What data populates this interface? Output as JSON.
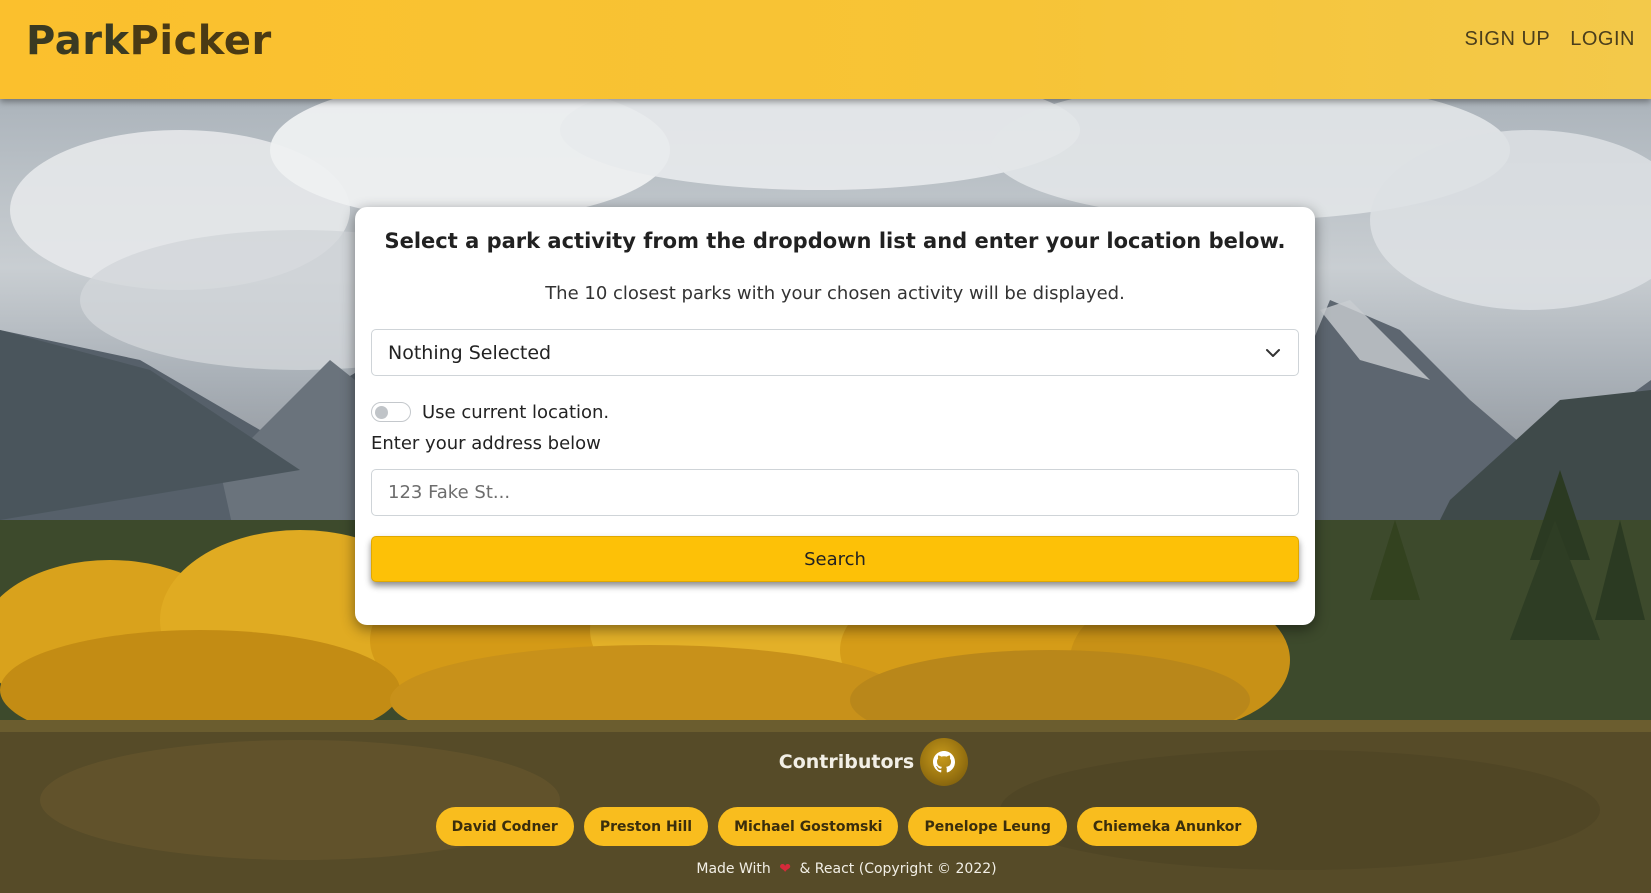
{
  "header": {
    "logo_part1": "Park",
    "logo_part2": "Picker",
    "nav": [
      "SIGN UP",
      "LOGIN"
    ]
  },
  "card": {
    "title": "Select a park activity from the dropdown list and enter your location below.",
    "subtitle": "The 10 closest parks with your chosen activity will be displayed.",
    "activity_select": {
      "value": "Nothing Selected",
      "icon": "chevron-down-icon"
    },
    "location_toggle": {
      "label": "Use current location.",
      "on": false
    },
    "address_label": "Enter your address below",
    "address_input": {
      "placeholder": "123 Fake St...",
      "value": ""
    },
    "search_label": "Search"
  },
  "footer": {
    "contributors_title": "Contributors",
    "github_icon": "github-icon",
    "contributors": [
      "David Codner",
      "Preston Hill",
      "Michael Gostomski",
      "Penelope Leung",
      "Chiemeka Anunkor"
    ],
    "made_with_prefix": "Made With",
    "made_with_suffix": "& React (Copyright © 2022)",
    "heart_icon": "heart-icon"
  },
  "colors": {
    "accent": "#fdc107",
    "header_bg": "#fbc02d",
    "pill_bg": "#f9bd1e"
  }
}
